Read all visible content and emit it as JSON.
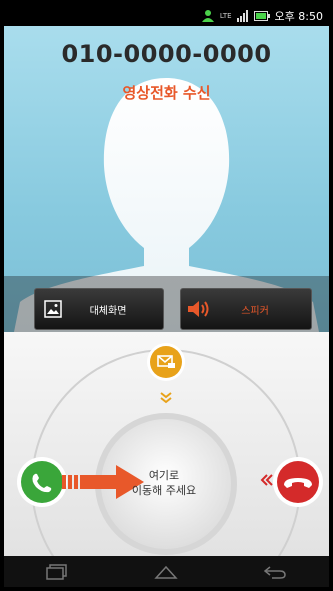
{
  "status_bar": {
    "network_label": "LTE",
    "time": "오후 8:50",
    "icons": [
      "person-icon",
      "lte-signal-icon",
      "signal-bars-icon",
      "battery-icon"
    ]
  },
  "call": {
    "number": "010-0000-0000",
    "type_label": "영상전화 수신"
  },
  "photo_buttons": {
    "alt_screen_label": "대체화면",
    "speaker_label": "스피커"
  },
  "unlock": {
    "instruction_line1": "여기로",
    "instruction_line2": "이동해 주세요"
  },
  "colors": {
    "accept": "#3aa63a",
    "reject": "#d42a2a",
    "message": "#e8a21a",
    "accent_text": "#e8582a"
  },
  "nav_icons": [
    "recent-apps-icon",
    "home-icon",
    "back-icon"
  ]
}
